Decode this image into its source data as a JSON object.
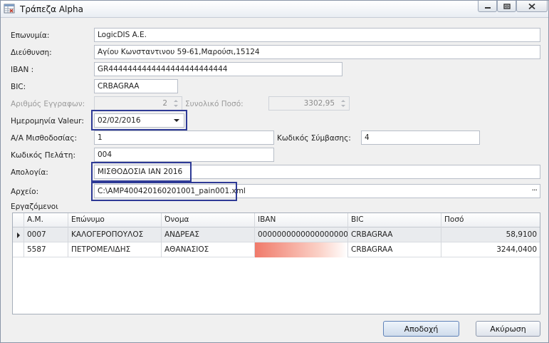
{
  "window": {
    "title": "Τράπεζα Alpha"
  },
  "form": {
    "name": {
      "label": "Επωνυμία:",
      "value": "LogicDIS A.E."
    },
    "address": {
      "label": "Διεύθυνση:",
      "value": "Αγίου Κωνσταντινου 59-61,Μαρούσι,15124"
    },
    "iban": {
      "label": "IBAN :",
      "value": "GR4444444444444444444444444"
    },
    "bic": {
      "label": "BIC:",
      "value": "CRBAGRAA"
    },
    "doc_count": {
      "label": "Αριθμός Εγγραφων:",
      "value": "2"
    },
    "total_amount": {
      "label": "Συνολικό Ποσό:",
      "value": "3302,95"
    },
    "value_date": {
      "label": "Ημερομηνία Valeur:",
      "value": "02/02/2016"
    },
    "payroll_no": {
      "label": "Α/Α Μισθοδοσίας:",
      "value": "1"
    },
    "contract_code": {
      "label": "Κωδικός Σύμβασης:",
      "value": "4"
    },
    "customer_code": {
      "label": "Κωδικός Πελάτη:",
      "value": "004"
    },
    "reason": {
      "label": "Απολογία:",
      "value": "ΜΙΣΘΟΔΟΣΙΑ ΙΑΝ 2016"
    },
    "file": {
      "label": "Αρχείο:",
      "value": "C:\\AMP400420160201001_pain001.xml",
      "browse": "···"
    }
  },
  "employees": {
    "label": "Εργαζόμενοι",
    "columns": [
      "Α.Μ.",
      "Επώνυμο",
      "Όνομα",
      "IBAN",
      "BIC",
      "Ποσό"
    ],
    "rows": [
      {
        "am": "0007",
        "surname": "ΚΑΛΟΓΕΡΟΠΟΥΛΟΣ",
        "name": "ΑΝΔΡΕΑΣ",
        "iban": "0000000000000000000...",
        "bic": "CRBAGRAA",
        "amount": "58,9100"
      },
      {
        "am": "5587",
        "surname": "ΠΕΤΡΟΜΕΛΙΔΗΣ",
        "name": "ΑΘΑΝΑΣΙΟΣ",
        "iban": "",
        "bic": "CRBAGRAA",
        "amount": "3244,0400"
      }
    ]
  },
  "buttons": {
    "ok": "Αποδοχή",
    "cancel": "Ακύρωση"
  },
  "icons": {
    "app": "spreadsheet-icon",
    "row_indicator": "row-pointer-icon"
  },
  "colors": {
    "highlight_border": "#2e3a96",
    "iban_error": "#f07a6a"
  }
}
